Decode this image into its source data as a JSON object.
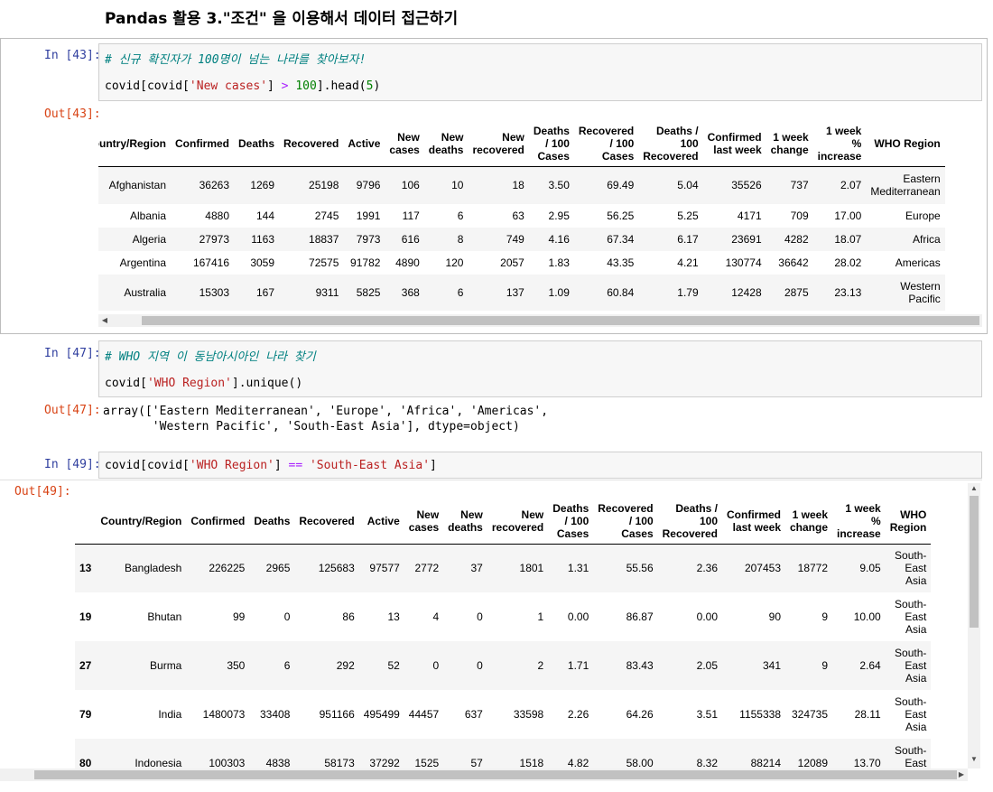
{
  "heading": "Pandas 활용 3.\"조건\" 을 이용해서 데이터 접근하기",
  "cell43": {
    "in_prompt": "In [43]:",
    "out_prompt": "Out[43]:",
    "comment": "# 신규 확진자가 100명이 넘는 나라를 찾아보자!",
    "code": {
      "p1": "covid[covid[",
      "s1": "'New cases'",
      "p2": "] ",
      "op": ">",
      "p3": " ",
      "num": "100",
      "p4": "].head(",
      "num2": "5",
      "p5": ")"
    },
    "columns": [
      "Country/Region",
      "Confirmed",
      "Deaths",
      "Recovered",
      "Active",
      "New\ncases",
      "New\ndeaths",
      "New\nrecovered",
      "Deaths\n/ 100\nCases",
      "Recovered\n/ 100\nCases",
      "Deaths /\n100\nRecovered",
      "Confirmed\nlast week",
      "1 week\nchange",
      "1 week\n%\nincrease",
      "WHO Region"
    ],
    "rows": [
      [
        "Afghanistan",
        "36263",
        "1269",
        "25198",
        "9796",
        "106",
        "10",
        "18",
        "3.50",
        "69.49",
        "5.04",
        "35526",
        "737",
        "2.07",
        "Eastern\nMediterranean"
      ],
      [
        "Albania",
        "4880",
        "144",
        "2745",
        "1991",
        "117",
        "6",
        "63",
        "2.95",
        "56.25",
        "5.25",
        "4171",
        "709",
        "17.00",
        "Europe"
      ],
      [
        "Algeria",
        "27973",
        "1163",
        "18837",
        "7973",
        "616",
        "8",
        "749",
        "4.16",
        "67.34",
        "6.17",
        "23691",
        "4282",
        "18.07",
        "Africa"
      ],
      [
        "Argentina",
        "167416",
        "3059",
        "72575",
        "91782",
        "4890",
        "120",
        "2057",
        "1.83",
        "43.35",
        "4.21",
        "130774",
        "36642",
        "28.02",
        "Americas"
      ],
      [
        "Australia",
        "15303",
        "167",
        "9311",
        "5825",
        "368",
        "6",
        "137",
        "1.09",
        "60.84",
        "1.79",
        "12428",
        "2875",
        "23.13",
        "Western\nPacific"
      ]
    ]
  },
  "cell47": {
    "in_prompt": "In [47]:",
    "out_prompt": "Out[47]:",
    "comment": "# WHO 지역 이 동남아시아인 나라 찾기",
    "code": {
      "p1": "covid[",
      "s1": "'WHO Region'",
      "p2": "].unique()"
    },
    "output_line1": "array(['Eastern Mediterranean', 'Europe', 'Africa', 'Americas',",
    "output_line2": "       'Western Pacific', 'South-East Asia'], dtype=object)"
  },
  "cell49": {
    "in_prompt": "In [49]:",
    "out_prompt": "Out[49]:",
    "code": {
      "p1": "covid[covid[",
      "s1": "'WHO Region'",
      "p2": "] ",
      "op": "==",
      "p3": " ",
      "s2": "'South-East Asia'",
      "p4": "]"
    },
    "columns": [
      "",
      "Country/Region",
      "Confirmed",
      "Deaths",
      "Recovered",
      "Active",
      "New\ncases",
      "New\ndeaths",
      "New\nrecovered",
      "Deaths\n/ 100\nCases",
      "Recovered\n/ 100\nCases",
      "Deaths /\n100\nRecovered",
      "Confirmed\nlast week",
      "1 week\nchange",
      "1 week\n%\nincrease",
      "WHO\nRegion"
    ],
    "rows": [
      [
        "13",
        "Bangladesh",
        "226225",
        "2965",
        "125683",
        "97577",
        "2772",
        "37",
        "1801",
        "1.31",
        "55.56",
        "2.36",
        "207453",
        "18772",
        "9.05",
        "South-\nEast\nAsia"
      ],
      [
        "19",
        "Bhutan",
        "99",
        "0",
        "86",
        "13",
        "4",
        "0",
        "1",
        "0.00",
        "86.87",
        "0.00",
        "90",
        "9",
        "10.00",
        "South-\nEast\nAsia"
      ],
      [
        "27",
        "Burma",
        "350",
        "6",
        "292",
        "52",
        "0",
        "0",
        "2",
        "1.71",
        "83.43",
        "2.05",
        "341",
        "9",
        "2.64",
        "South-\nEast\nAsia"
      ],
      [
        "79",
        "India",
        "1480073",
        "33408",
        "951166",
        "495499",
        "44457",
        "637",
        "33598",
        "2.26",
        "64.26",
        "3.51",
        "1155338",
        "324735",
        "28.11",
        "South-\nEast\nAsia"
      ],
      [
        "80",
        "Indonesia",
        "100303",
        "4838",
        "58173",
        "37292",
        "1525",
        "57",
        "1518",
        "4.82",
        "58.00",
        "8.32",
        "88214",
        "12089",
        "13.70",
        "South-\nEast\nAsia"
      ]
    ]
  },
  "scroll": {
    "left_arrow": "◀",
    "right_arrow": "▶",
    "up_arrow": "▲",
    "down_arrow": "▼"
  }
}
